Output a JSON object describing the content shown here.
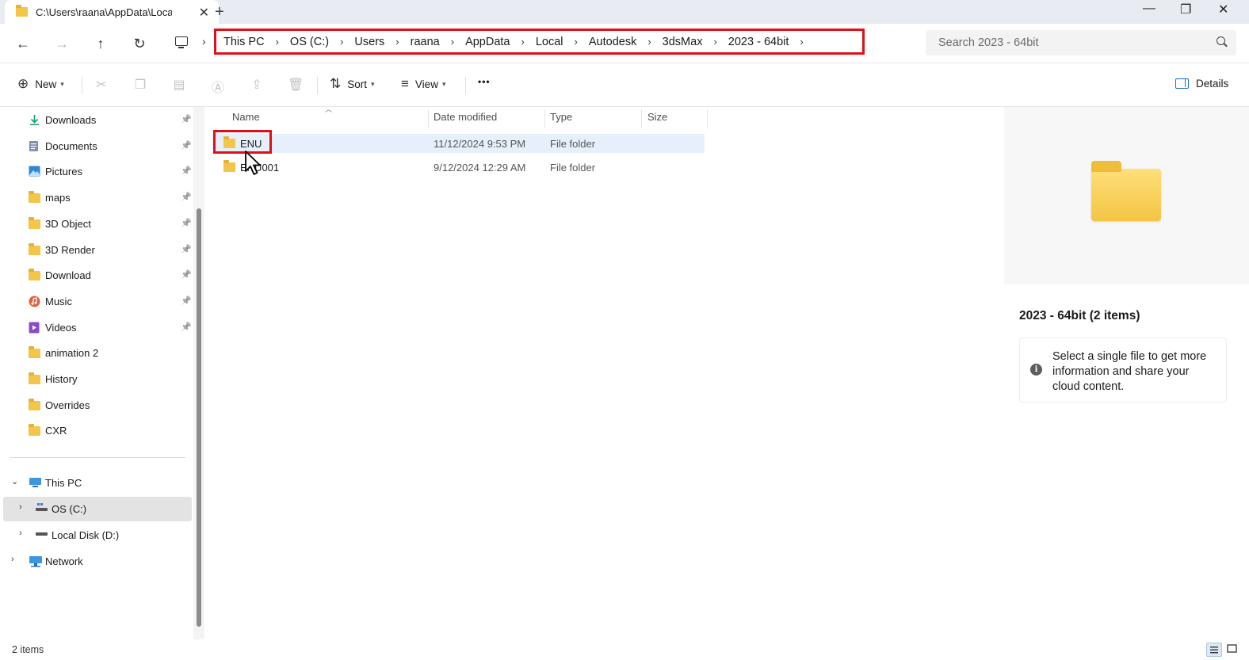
{
  "window": {
    "tab_title": "C:\\Users\\raana\\AppData\\Local",
    "tab_close": "✕",
    "new_tab": "+",
    "minimize": "—",
    "maximize": "❐",
    "close": "✕"
  },
  "address": {
    "crumbs": [
      "This PC",
      "OS (C:)",
      "Users",
      "raana",
      "AppData",
      "Local",
      "Autodesk",
      "3dsMax",
      "2023 - 64bit"
    ],
    "search_placeholder": "Search 2023 - 64bit"
  },
  "toolbar": {
    "new_label": "New",
    "sort_label": "Sort",
    "view_label": "View",
    "more_label": "•••",
    "details_label": "Details"
  },
  "sidebar": {
    "quick_access": [
      {
        "label": "Downloads",
        "icon": "download-icon"
      },
      {
        "label": "Documents",
        "icon": "documents-icon"
      },
      {
        "label": "Pictures",
        "icon": "pictures-icon"
      },
      {
        "label": "maps",
        "icon": "folder-icon"
      },
      {
        "label": "3D Object",
        "icon": "folder-icon"
      },
      {
        "label": "3D Render",
        "icon": "folder-icon"
      },
      {
        "label": "Download",
        "icon": "folder-icon"
      },
      {
        "label": "Music",
        "icon": "music-icon"
      },
      {
        "label": "Videos",
        "icon": "videos-icon"
      },
      {
        "label": "animation 2",
        "icon": "folder-icon"
      },
      {
        "label": "History",
        "icon": "folder-icon"
      },
      {
        "label": "Overrides",
        "icon": "folder-icon"
      },
      {
        "label": "CXR",
        "icon": "folder-icon"
      }
    ],
    "this_pc": "This PC",
    "drives": [
      "OS (C:)",
      "Local Disk (D:)"
    ],
    "network": "Network"
  },
  "columns": [
    "Name",
    "Date modified",
    "Type",
    "Size"
  ],
  "files": [
    {
      "name": "ENU",
      "date": "11/12/2024 9:53 PM",
      "type": "File folder",
      "size": ""
    },
    {
      "name": "ENU001",
      "date": "9/12/2024 12:29 AM",
      "type": "File folder",
      "size": ""
    }
  ],
  "details": {
    "title": "2023 - 64bit (2 items)",
    "info": "Select a single file to get more information and share your cloud content.",
    "info_glyph": "i"
  },
  "status": {
    "items": "2 items"
  },
  "colors": {
    "accent": "#1a6fc9",
    "highlight": "#e0101a",
    "folder": "#f3c54a",
    "selection": "#e5f0fb"
  }
}
